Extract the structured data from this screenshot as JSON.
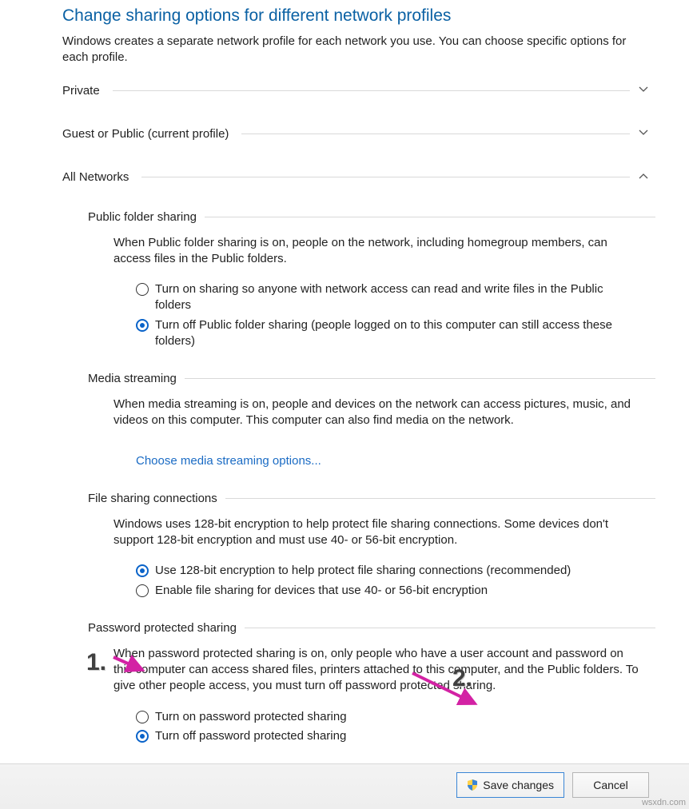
{
  "header": {
    "title": "Change sharing options for different network profiles",
    "description": "Windows creates a separate network profile for each network you use. You can choose specific options for each profile."
  },
  "profiles": {
    "private": {
      "label": "Private"
    },
    "guest": {
      "label": "Guest or Public (current profile)"
    },
    "all": {
      "label": "All Networks"
    }
  },
  "public_folder": {
    "title": "Public folder sharing",
    "desc": "When Public folder sharing is on, people on the network, including homegroup members, can access files in the Public folders.",
    "opt_on": "Turn on sharing so anyone with network access can read and write files in the Public folders",
    "opt_off": "Turn off Public folder sharing (people logged on to this computer can still access these folders)"
  },
  "media": {
    "title": "Media streaming",
    "desc": "When media streaming is on, people and devices on the network can access pictures, music, and videos on this computer. This computer can also find media on the network.",
    "link": "Choose media streaming options..."
  },
  "filesharing": {
    "title": "File sharing connections",
    "desc": "Windows uses 128-bit encryption to help protect file sharing connections. Some devices don't support 128-bit encryption and must use 40- or 56-bit encryption.",
    "opt_128": "Use 128-bit encryption to help protect file sharing connections (recommended)",
    "opt_40": "Enable file sharing for devices that use 40- or 56-bit encryption"
  },
  "password": {
    "title": "Password protected sharing",
    "desc": "When password protected sharing is on, only people who have a user account and password on this computer can access shared files, printers attached to this computer, and the Public folders. To give other people access, you must turn off password protected sharing.",
    "opt_on": "Turn on password protected sharing",
    "opt_off": "Turn off password protected sharing"
  },
  "buttons": {
    "save": "Save changes",
    "cancel": "Cancel"
  },
  "annotations": {
    "one": "1.",
    "two": "2."
  },
  "watermark": "wsxdn.com"
}
